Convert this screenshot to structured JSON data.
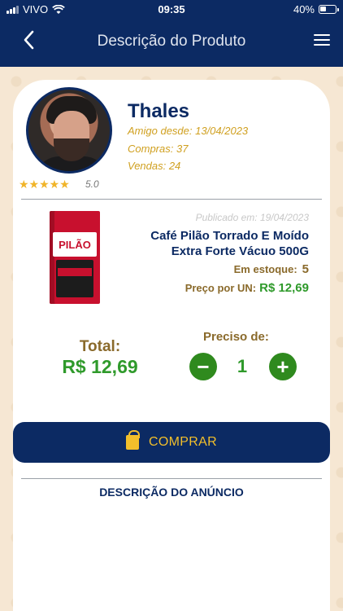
{
  "status_bar": {
    "carrier": "VIVO",
    "time": "09:35",
    "battery": "40%"
  },
  "header": {
    "title": "Descrição do Produto",
    "back_icon": "chevron-left-icon",
    "menu_icon": "hamburger-menu-icon"
  },
  "seller": {
    "name": "Thales",
    "friend_since": "Amigo desde:  13/04/2023",
    "purchases": "Compras: 37",
    "sales": "Vendas: 24",
    "stars": "★★★★★",
    "rating": "5.0"
  },
  "product": {
    "published": "Publicado em: 19/04/2023",
    "title": "Café Pilão Torrado E Moído Extra Forte Vácuo 500G",
    "stock_label": "Em estoque:",
    "stock_value": "5",
    "unit_price_label": "Preço por UN:",
    "unit_price_value": "R$ 12,69",
    "image_brand": "PILÃO"
  },
  "order": {
    "total_label": "Total:",
    "total_value": "R$ 12,69",
    "need_label": "Preciso de:",
    "quantity": "1",
    "minus": "−",
    "plus": "+"
  },
  "buy_button": {
    "label": "COMPRAR",
    "icon": "shopping-bag-icon"
  },
  "description": {
    "title": "DESCRIÇÃO DO ANÚNCIO"
  },
  "colors": {
    "primary": "#0c2a63",
    "accent_gold": "#f2bf2b",
    "price_green": "#2f9a2b",
    "brown_text": "#8a6a2b"
  }
}
